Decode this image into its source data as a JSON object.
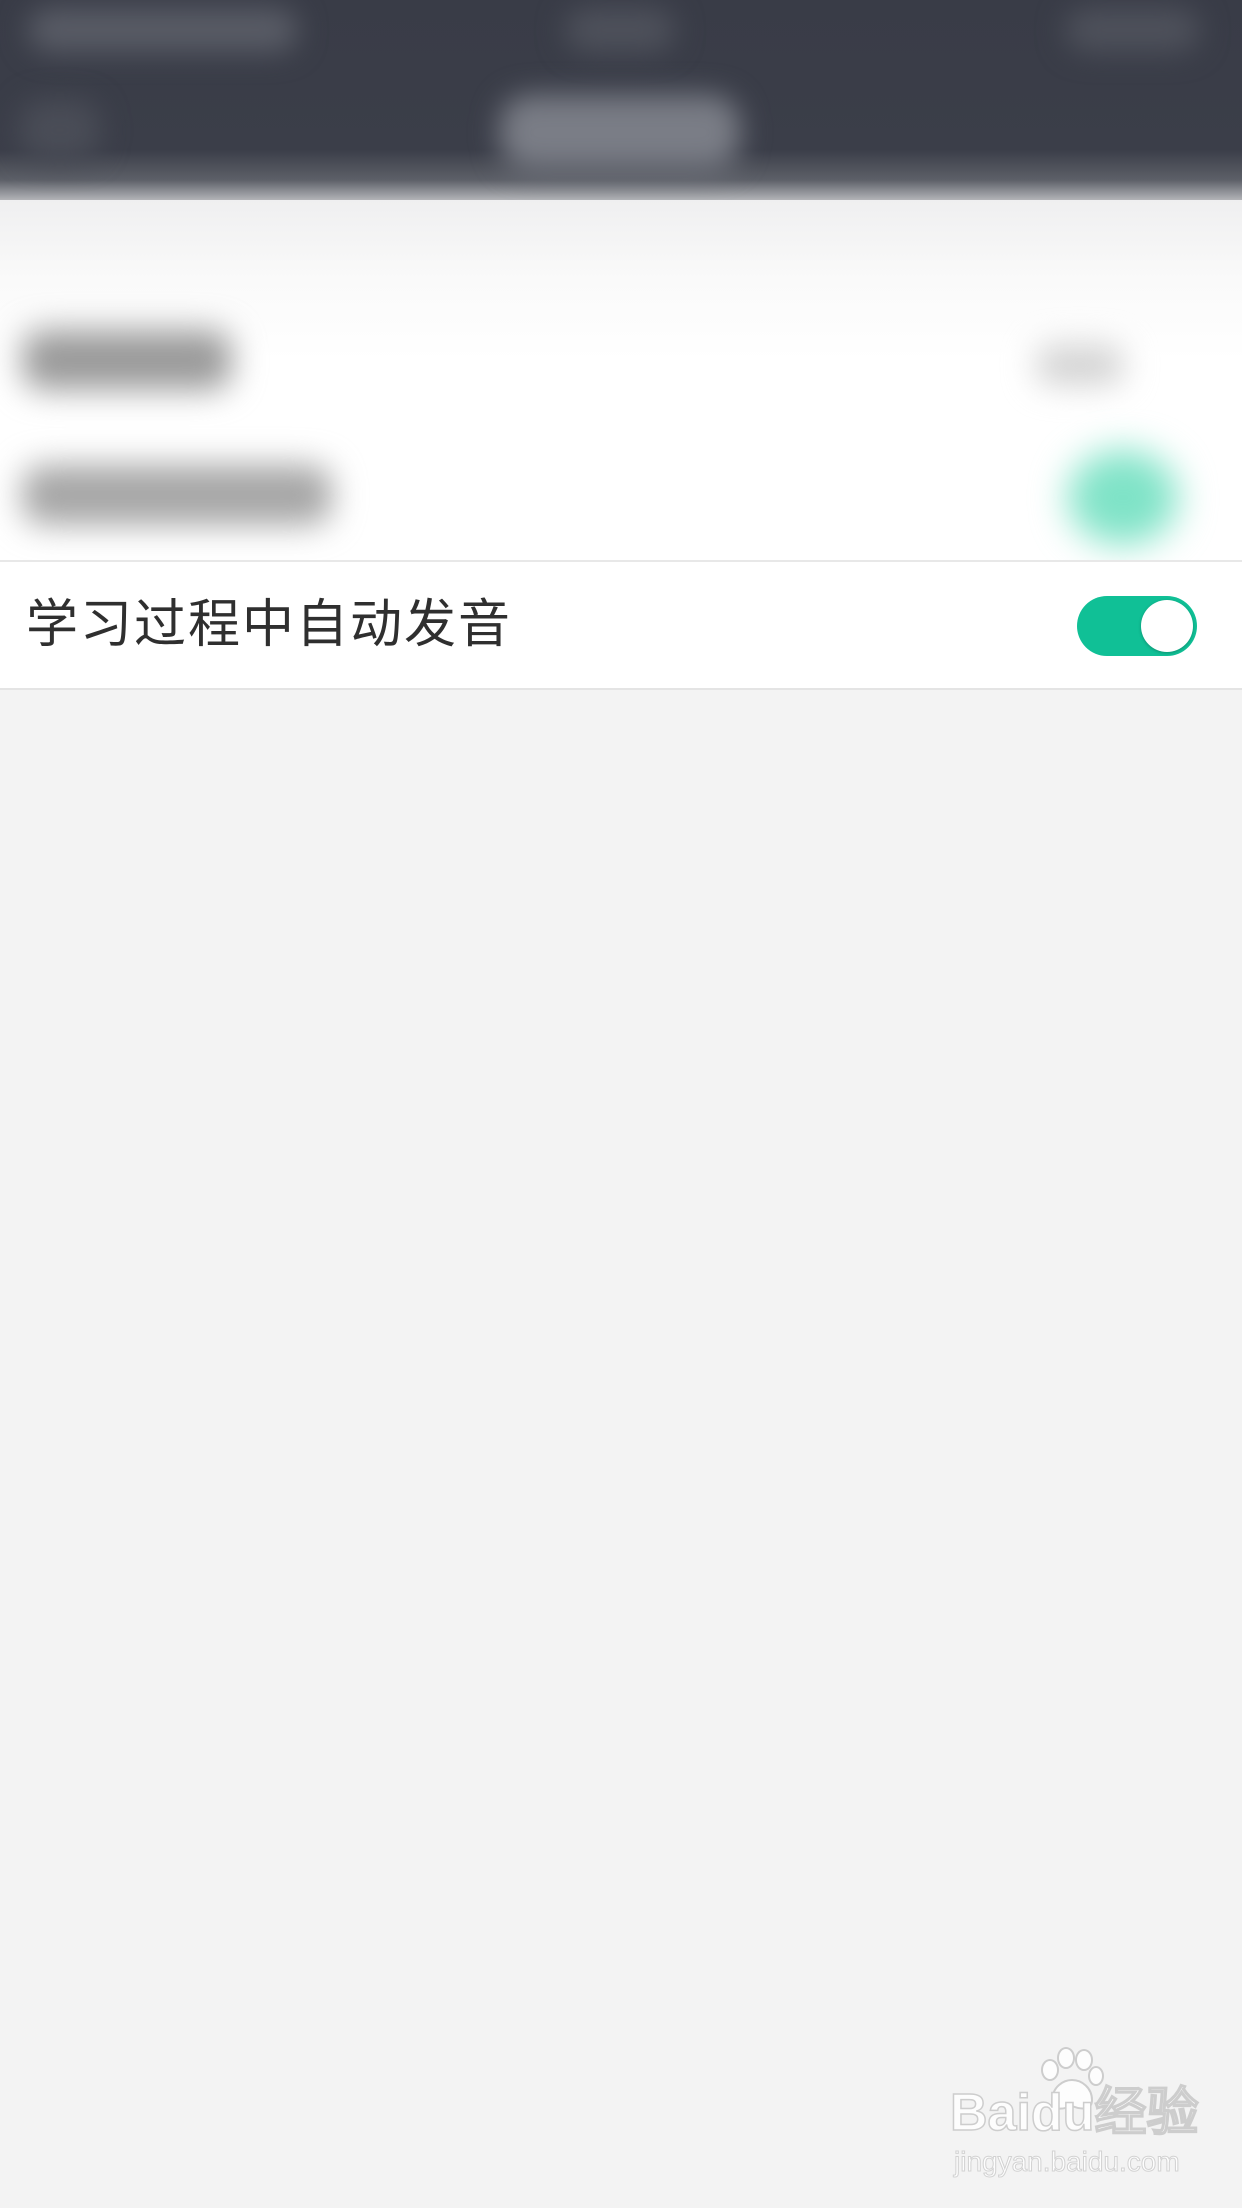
{
  "settings": {
    "auto_pronounce": {
      "label": "学习过程中自动发音",
      "enabled": true
    }
  },
  "colors": {
    "toggle_on": "#10c096",
    "header_bg": "#393c47",
    "page_bg": "#f3f3f3"
  },
  "watermark": {
    "logo_text": "Baidu经验",
    "url": "jingyan.baidu.com",
    "icon": "baidu-paw-icon"
  }
}
